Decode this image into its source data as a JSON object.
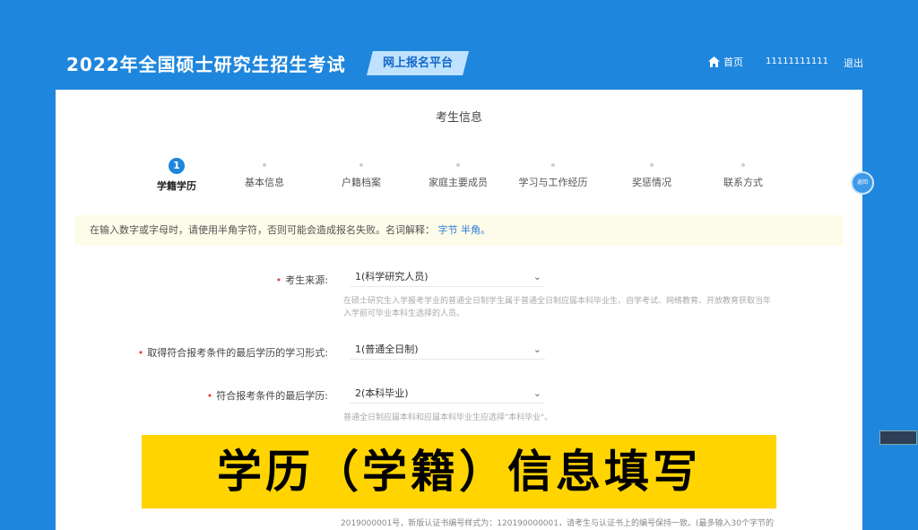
{
  "header": {
    "title": "2022年全国硕士研究生招生考试",
    "platform": "网上报名平台",
    "nav": {
      "home": "首页",
      "user": "11111111111",
      "logout": "退出"
    }
  },
  "panel": {
    "title": "考生信息",
    "steps": [
      {
        "num": "1",
        "label": "学籍学历"
      },
      {
        "label": "基本信息"
      },
      {
        "label": "户籍档案"
      },
      {
        "label": "家庭主要成员"
      },
      {
        "label": "学习与工作经历"
      },
      {
        "label": "奖惩情况"
      },
      {
        "label": "联系方式"
      }
    ],
    "notice": "在输入数字或字母时，请使用半角字符，否则可能会造成报名失败。名词解释：",
    "notice_link": "字节 半角。",
    "side_button": "返回",
    "fields": [
      {
        "label": "考生来源:",
        "value": "1(科学研究人员)",
        "help": "在硕士研究生入学报考学业的普通全日制学生属于普通全日制应届本科毕业生、自学考试、网络教育、开放教育获取当年入学前可毕业本科生选择的人员。"
      },
      {
        "label": "取得符合报考条件的最后学历的学习形式:",
        "value": "1(普通全日制)"
      },
      {
        "label": "符合报考条件的最后学历:",
        "value": "2(本科毕业)",
        "help": "普通全日制应届本科和应届本科毕业生应选择\"本科毕业\"。"
      }
    ],
    "bottom_help": "2019000001号，新版认证书编号样式为：120190000001，请考生与认证书上的编号保持一致。(最多输入30个字节的"
  },
  "caption": "学历（学籍）信息填写",
  "colors": {
    "primary": "#1f86dd",
    "banner": "#ffd400"
  }
}
